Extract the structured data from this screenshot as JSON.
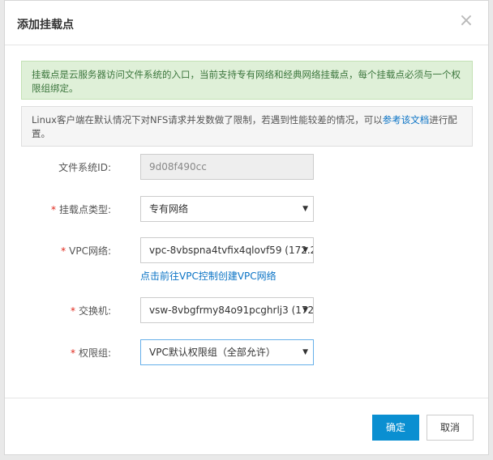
{
  "dialog": {
    "title": "添加挂载点",
    "close_glyph": "×"
  },
  "tips": {
    "green": "挂载点是云服务器访问文件系统的入口，当前支持专有网络和经典网络挂载点，每个挂载点必须与一个权限组绑定。",
    "gray_before": "Linux客户端在默认情况下对NFS请求并发数做了限制，若遇到性能较差的情况，可以",
    "gray_link": "参考该文档",
    "gray_after": "进行配置。"
  },
  "form": {
    "fs_id": {
      "label": "文件系统ID:",
      "value": "9d08f490cc"
    },
    "mount_type": {
      "required": "*",
      "label": "挂载点类型:",
      "value": "专有网络"
    },
    "vpc": {
      "required": "*",
      "label": "VPC网络:",
      "value": "vpc-8vbspna4tvfix4qlovf59 (172.2",
      "link": "点击前往VPC控制创建VPC网络"
    },
    "vswitch": {
      "required": "*",
      "label": "交换机:",
      "value": "vsw-8vbgfrmy84o91pcghrlj3 (172"
    },
    "perm_group": {
      "required": "*",
      "label": "权限组:",
      "value": "VPC默认权限组（全部允许）"
    },
    "caret": "▼"
  },
  "footer": {
    "confirm": "确定",
    "cancel": "取消"
  },
  "colors": {
    "primary": "#0a8fd1",
    "tip_green_bg": "#dff0d8",
    "tip_green_text": "#3c763d",
    "link": "#0a73c5",
    "required": "#e0271b"
  }
}
